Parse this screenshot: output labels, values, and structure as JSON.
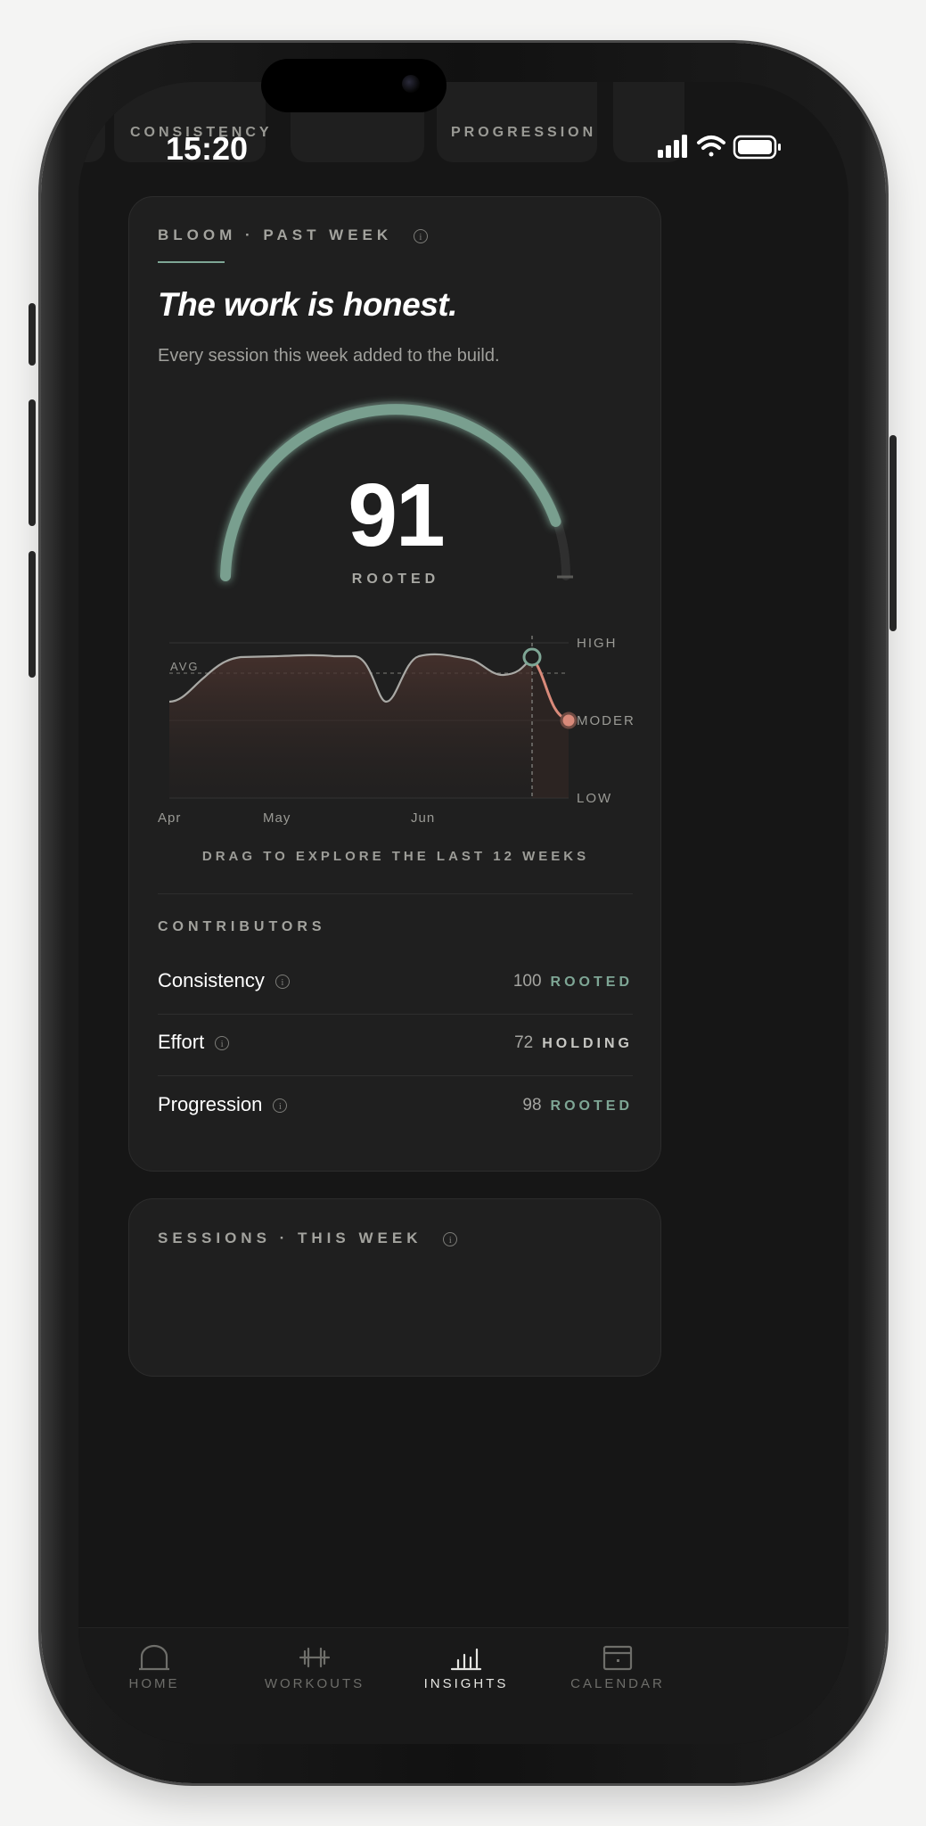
{
  "status_bar": {
    "time": "15:20"
  },
  "top_tiles": [
    {
      "label": "CONSISTENCY"
    },
    {
      "label": ""
    },
    {
      "label": "PROGRESSION"
    }
  ],
  "bloom_card": {
    "kicker": "BLOOM · PAST WEEK",
    "headline": "The work is honest.",
    "subline": "Every session this week added to the build.",
    "score": "91",
    "score_label": "ROOTED",
    "trend": {
      "levels": [
        "HIGH",
        "MODERATE",
        "LOW"
      ],
      "avg_label": "AVG",
      "months": [
        "Apr",
        "May",
        "Jun"
      ],
      "drag_hint": "DRAG TO EXPLORE THE LAST 12 WEEKS"
    },
    "contributors_title": "CONTRIBUTORS",
    "contributors": [
      {
        "name": "Consistency",
        "value": "100",
        "status": "ROOTED"
      },
      {
        "name": "Effort",
        "value": "72",
        "status": "HOLDING"
      },
      {
        "name": "Progression",
        "value": "98",
        "status": "ROOTED"
      }
    ]
  },
  "sessions_card": {
    "kicker": "SESSIONS · THIS WEEK"
  },
  "tabbar": [
    {
      "label": "HOME",
      "icon": "home-arch-icon"
    },
    {
      "label": "WORKOUTS",
      "icon": "dumbbell-icon"
    },
    {
      "label": "INSIGHTS",
      "icon": "bar-chart-icon",
      "active": true
    },
    {
      "label": "CALENDAR",
      "icon": "calendar-icon"
    }
  ],
  "colors": {
    "accent_green": "#7ea695",
    "alert_coral": "#d98a7a",
    "background": "#161616",
    "card": "#1f1f1f"
  }
}
